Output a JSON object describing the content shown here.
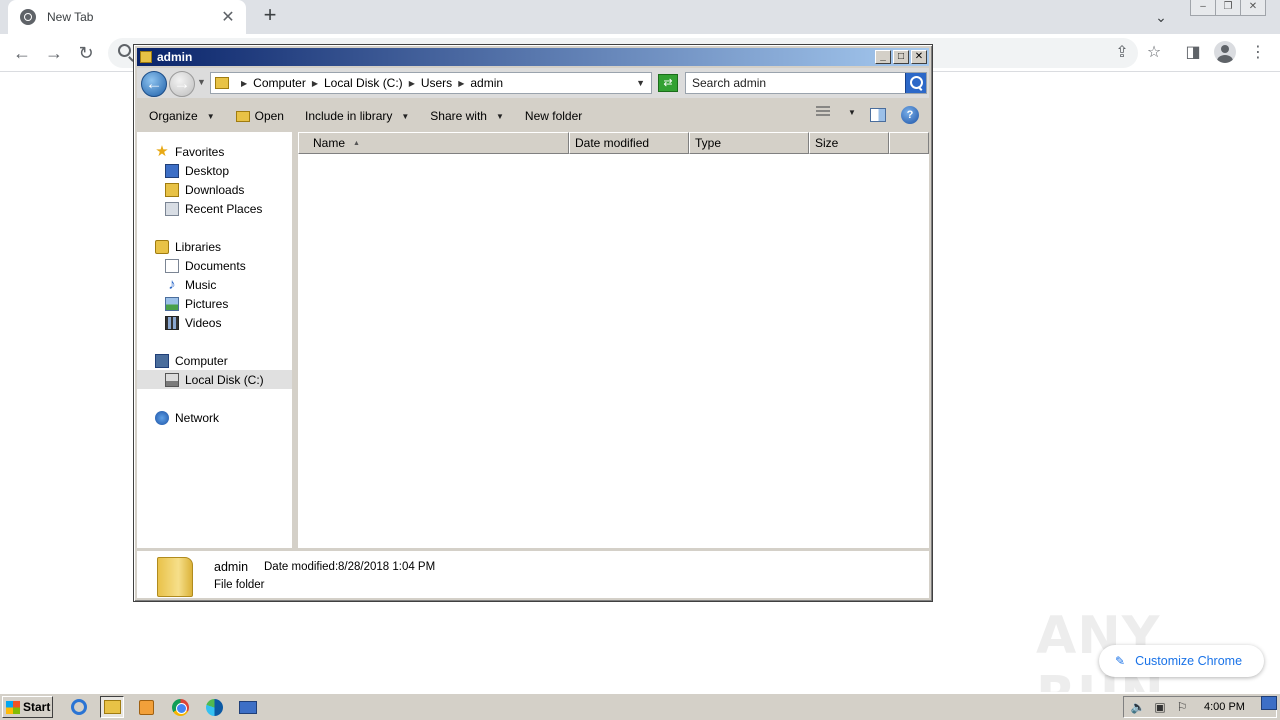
{
  "chrome": {
    "tab_title": "New Tab",
    "tab_close_glyph": "✕",
    "new_tab_glyph": "+",
    "customize_label": "Customize Chrome",
    "watermark": "ANY RUN"
  },
  "explorer": {
    "title": "admin",
    "title_buttons": [
      "_",
      "□",
      "✕"
    ],
    "address": {
      "crumbs": [
        "Computer",
        "Local Disk (C:)",
        "Users",
        "admin"
      ]
    },
    "search_placeholder": "Search admin",
    "commands": {
      "organize": "Organize",
      "open": "Open",
      "include_in_library": "Include in library",
      "share_with": "Share with",
      "new_folder": "New folder"
    },
    "help_glyph": "?",
    "nav": {
      "favorites": "Favorites",
      "desktop": "Desktop",
      "downloads": "Downloads",
      "recent_places": "Recent Places",
      "libraries": "Libraries",
      "documents": "Documents",
      "music": "Music",
      "pictures": "Pictures",
      "videos": "Videos",
      "computer": "Computer",
      "local_disk": "Local Disk (C:)",
      "network": "Network"
    },
    "columns": [
      "Name",
      "Date modified",
      "Type",
      "Size"
    ],
    "details": {
      "name": "admin",
      "date_label": "Date modified:",
      "date_value": "8/28/2018 1:04 PM",
      "type": "File folder"
    }
  },
  "taskbar": {
    "start_label": "Start",
    "clock": "4:00 PM"
  }
}
